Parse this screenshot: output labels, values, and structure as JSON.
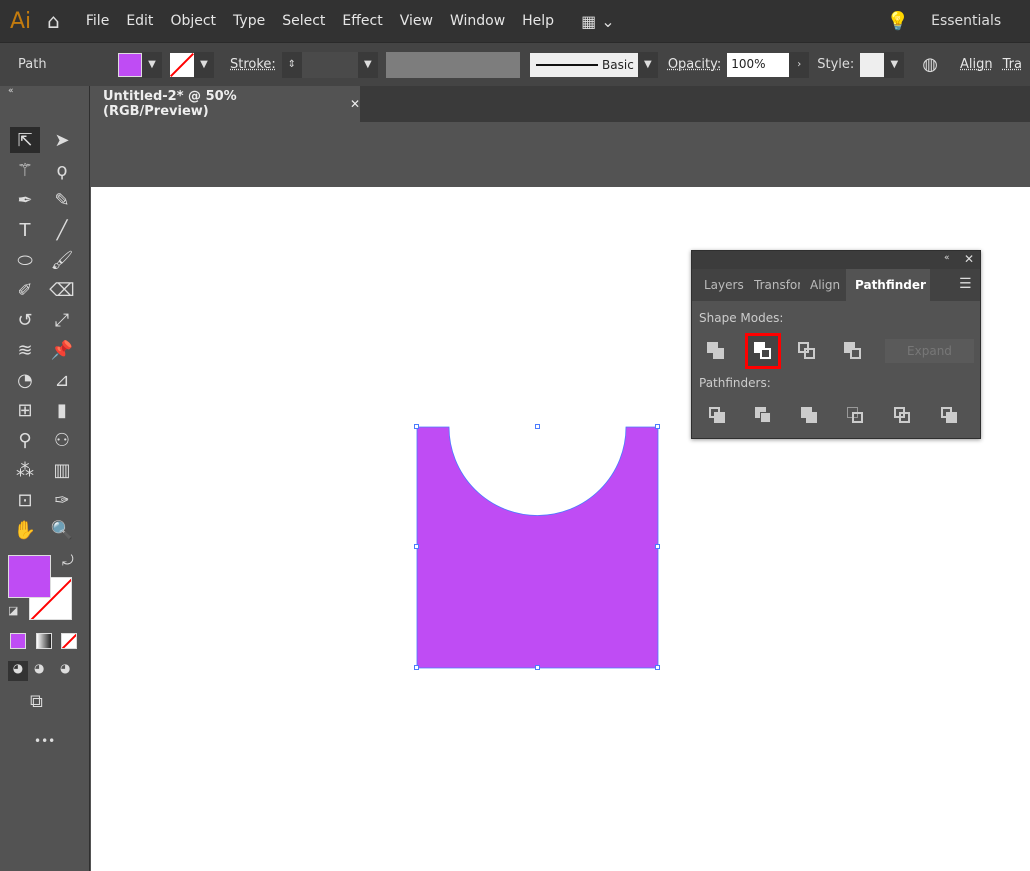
{
  "app": {
    "logo": "Ai",
    "workspace": "Essentials"
  },
  "menu": [
    "File",
    "Edit",
    "Object",
    "Type",
    "Select",
    "Effect",
    "View",
    "Window",
    "Help"
  ],
  "control": {
    "selection": "Path",
    "fill_color": "#bf4cf4",
    "stroke_label": "Stroke:",
    "brush": "Basic",
    "opacity_label": "Opacity:",
    "opacity": "100%",
    "style_label": "Style:",
    "align": "Align",
    "transform": "Tra"
  },
  "document": {
    "tab": "Untitled-2* @ 50% (RGB/Preview)",
    "close": "✕"
  },
  "panel": {
    "tabs": [
      "Layers",
      "Transfor",
      "Align",
      "Pathfinder"
    ],
    "active_tab": "Pathfinder",
    "shape_modes": "Shape Modes:",
    "expand": "Expand",
    "pathfinders": "Pathfinders:",
    "highlight_color": "#ff0000"
  },
  "toolbar": {
    "more": "•••"
  },
  "shape": {
    "fill": "#bf4cf4",
    "selection_color": "#4b7bff"
  }
}
